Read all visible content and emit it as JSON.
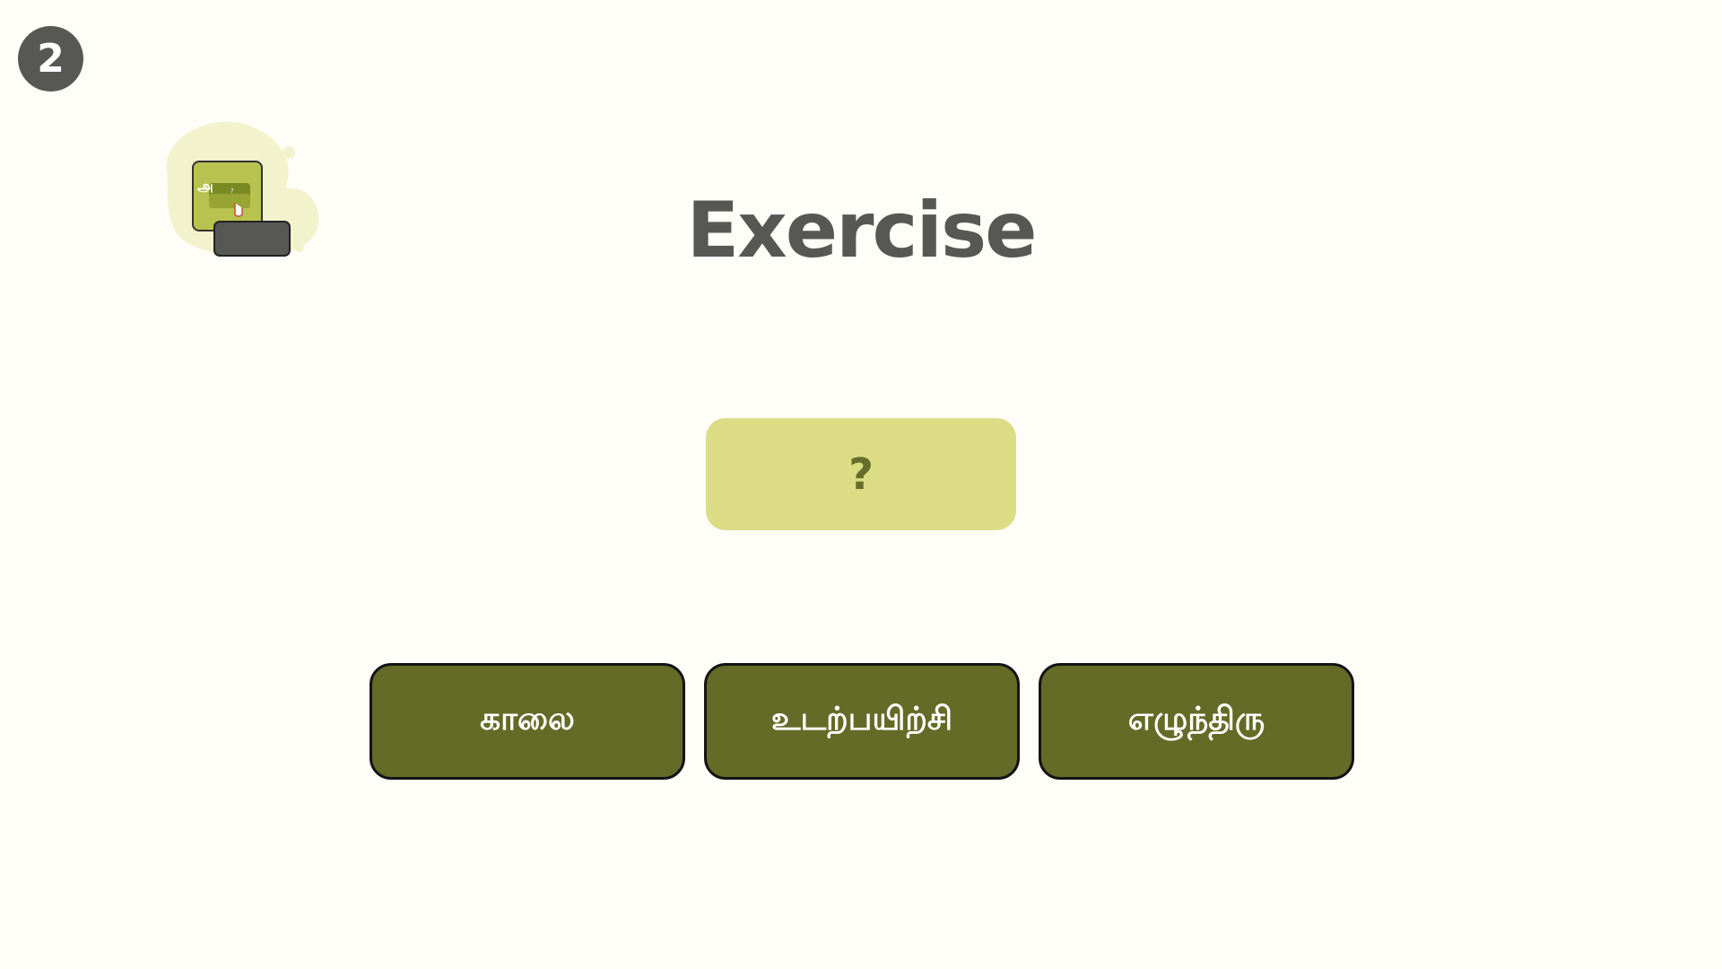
{
  "step": {
    "number": "2"
  },
  "header": {
    "title": "Exercise"
  },
  "answer": {
    "placeholder": "?"
  },
  "options": [
    {
      "label": "காலை"
    },
    {
      "label": "உடற்பயிற்சி"
    },
    {
      "label": "எழுந்திரு"
    }
  ],
  "colors": {
    "background": "#fefdf8",
    "badge": "#575754",
    "title": "#575754",
    "slot": "#dcdc85",
    "slot_text": "#666e2b",
    "option": "#646b27",
    "option_border": "#141414"
  },
  "icons": {
    "logo": "tamil-word-game-icon"
  }
}
